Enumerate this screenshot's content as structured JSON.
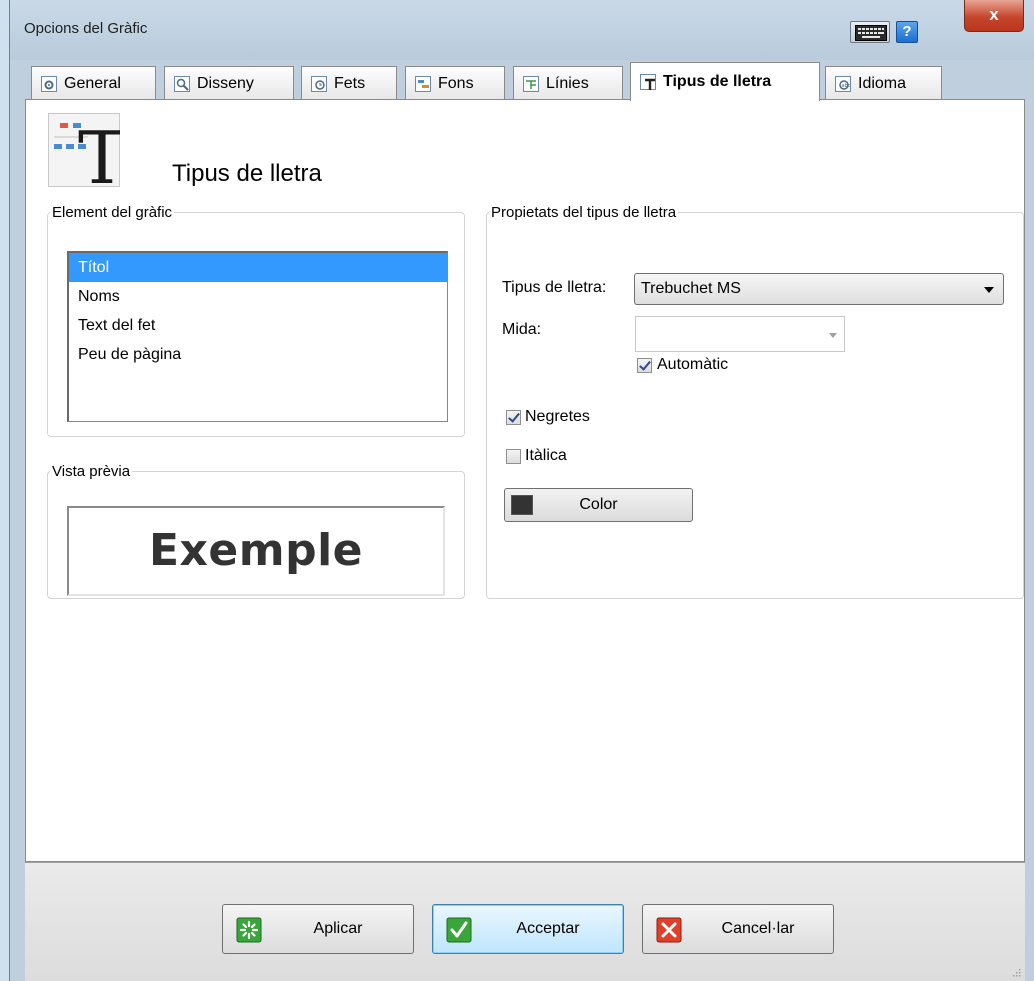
{
  "window": {
    "title": "Opcions del Gràfic",
    "help_label": "?",
    "close_label": "x"
  },
  "tabs": [
    {
      "label": "General",
      "icon": "gear-doc-icon",
      "active": false
    },
    {
      "label": "Disseny",
      "icon": "magnify-doc-icon",
      "active": false
    },
    {
      "label": "Fets",
      "icon": "clock-doc-icon",
      "active": false
    },
    {
      "label": "Fons",
      "icon": "background-doc-icon",
      "active": false
    },
    {
      "label": "Línies",
      "icon": "lines-doc-icon",
      "active": false
    },
    {
      "label": "Tipus de lletra",
      "icon": "font-doc-icon",
      "active": true
    },
    {
      "label": "Idioma",
      "icon": "language-doc-icon",
      "active": false
    }
  ],
  "header": {
    "title": "Tipus de lletra",
    "icon_glyph": "T"
  },
  "element_group": {
    "legend": "Element del gràfic",
    "items": [
      "Títol",
      "Noms",
      "Text del fet",
      "Peu de pàgina"
    ],
    "selected_index": 0
  },
  "preview_group": {
    "legend": "Vista prèvia",
    "sample_text": "Exemple"
  },
  "props_group": {
    "legend": "Propietats del tipus de lletra",
    "font_label": "Tipus de lletra:",
    "font_value": "Trebuchet MS",
    "size_label": "Mida:",
    "size_value": "",
    "auto_label": "Automàtic",
    "auto_checked": true,
    "bold_label": "Negretes",
    "bold_checked": true,
    "italic_label": "Itàlica",
    "italic_checked": false,
    "color_label": "Color",
    "color_value": "#333333"
  },
  "footer": {
    "apply_label": "Aplicar",
    "ok_label": "Acceptar",
    "cancel_label": "Cancel·lar"
  },
  "colors": {
    "selection": "#3399ff",
    "title_bar": "#bfcfdd",
    "close": "#c6462c"
  }
}
